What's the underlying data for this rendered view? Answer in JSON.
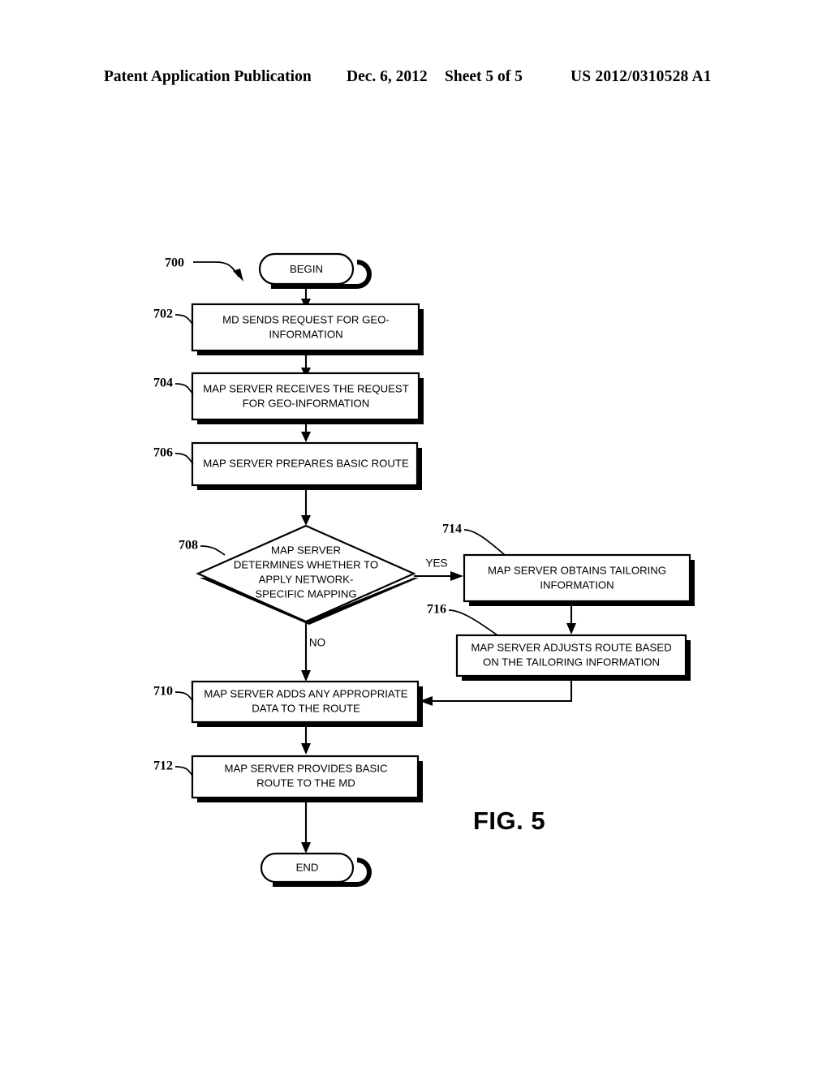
{
  "header": {
    "publication": "Patent Application Publication",
    "date": "Dec. 6, 2012",
    "sheet": "Sheet 5 of 5",
    "patent_number": "US 2012/0310528 A1"
  },
  "figure": {
    "caption": "FIG. 5",
    "diagram_ref": "700"
  },
  "nodes": {
    "begin": {
      "ref": "",
      "label": "BEGIN"
    },
    "n702": {
      "ref": "702",
      "line1": "MD SENDS REQUEST FOR GEO-",
      "line2": "INFORMATION"
    },
    "n704": {
      "ref": "704",
      "line1": "MAP SERVER RECEIVES THE REQUEST",
      "line2": "FOR GEO-INFORMATION"
    },
    "n706": {
      "ref": "706",
      "line1": "MAP SERVER PREPARES BASIC ROUTE",
      "line2": ""
    },
    "n708": {
      "ref": "708",
      "line1": "MAP SERVER",
      "line2": "DETERMINES WHETHER TO",
      "line3": "APPLY NETWORK-",
      "line4": "SPECIFIC MAPPING"
    },
    "n710": {
      "ref": "710",
      "line1": "MAP SERVER ADDS ANY APPROPRIATE",
      "line2": "DATA TO THE ROUTE"
    },
    "n712": {
      "ref": "712",
      "line1": "MAP SERVER PROVIDES BASIC",
      "line2": "ROUTE TO THE MD"
    },
    "n714": {
      "ref": "714",
      "line1": "MAP SERVER OBTAINS TAILORING",
      "line2": "INFORMATION"
    },
    "n716": {
      "ref": "716",
      "line1": "MAP SERVER ADJUSTS ROUTE BASED",
      "line2": "ON THE TAILORING INFORMATION"
    },
    "end": {
      "ref": "",
      "label": "END"
    }
  },
  "branches": {
    "yes": "YES",
    "no": "NO"
  },
  "colors": {
    "ink": "#000000",
    "paper": "#ffffff"
  }
}
